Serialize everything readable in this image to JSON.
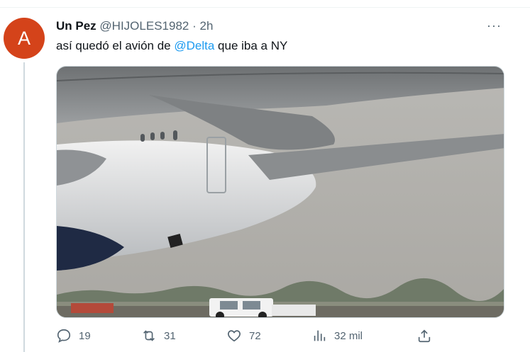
{
  "tweet": {
    "avatar_letter": "A",
    "display_name": "Un Pez",
    "handle": "@HIJOLES1982",
    "separator": "·",
    "time": "2h",
    "more_label": "···",
    "text_before": "así quedó el avión de ",
    "mention": "@Delta",
    "text_after": " que iba a NY",
    "media_alt": "damaged airplane wing photo"
  },
  "actions": {
    "replies": "19",
    "retweets": "31",
    "likes": "72",
    "views": "32 mil"
  },
  "colors": {
    "accent": "#1d9bf0",
    "avatar_bg": "#d4431a",
    "muted": "#536471"
  },
  "icons": [
    "reply-icon",
    "retweet-icon",
    "like-icon",
    "views-icon",
    "share-icon"
  ]
}
